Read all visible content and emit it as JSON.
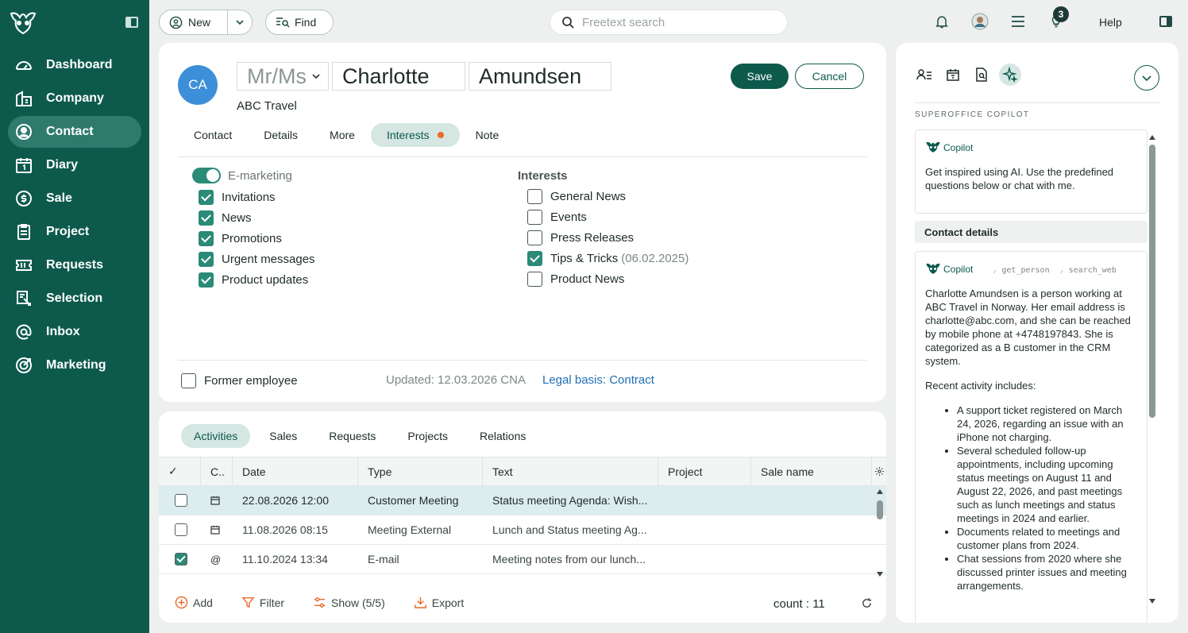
{
  "nav": {
    "items": [
      {
        "label": "Dashboard",
        "icon": "dashboard-icon"
      },
      {
        "label": "Company",
        "icon": "company-icon"
      },
      {
        "label": "Contact",
        "icon": "contact-icon"
      },
      {
        "label": "Diary",
        "icon": "diary-icon"
      },
      {
        "label": "Sale",
        "icon": "sale-icon"
      },
      {
        "label": "Project",
        "icon": "project-icon"
      },
      {
        "label": "Requests",
        "icon": "requests-icon"
      },
      {
        "label": "Selection",
        "icon": "selection-icon"
      },
      {
        "label": "Inbox",
        "icon": "inbox-icon"
      },
      {
        "label": "Marketing",
        "icon": "marketing-icon"
      }
    ],
    "active_index": 2
  },
  "topbar": {
    "new_label": "New",
    "find_label": "Find",
    "search_placeholder": "Freetext search",
    "notification_badge": "3",
    "help_label": "Help"
  },
  "contact": {
    "initials": "CA",
    "salutation": "Mr/Ms",
    "first_name": "Charlotte",
    "last_name": "Amundsen",
    "company": "ABC Travel",
    "save_label": "Save",
    "cancel_label": "Cancel",
    "tabs": [
      "Contact",
      "Details",
      "More",
      "Interests",
      "Note"
    ],
    "active_tab": "Interests"
  },
  "interests": {
    "emarketing_label": "E-marketing",
    "emarketing_on": true,
    "marketing_items": [
      {
        "label": "Invitations",
        "checked": true
      },
      {
        "label": "News",
        "checked": true
      },
      {
        "label": "Promotions",
        "checked": true
      },
      {
        "label": "Urgent messages",
        "checked": true
      },
      {
        "label": "Product updates",
        "checked": true
      }
    ],
    "heading": "Interests",
    "interest_items": [
      {
        "label": "General News",
        "checked": false,
        "date": ""
      },
      {
        "label": "Events",
        "checked": false,
        "date": ""
      },
      {
        "label": "Press Releases",
        "checked": false,
        "date": ""
      },
      {
        "label": "Tips & Tricks",
        "checked": true,
        "date": "(06.02.2025)"
      },
      {
        "label": "Product News",
        "checked": false,
        "date": ""
      }
    ],
    "former_employee_label": "Former employee",
    "updated_text": "Updated: 12.03.2026 CNA",
    "legal_basis_text": "Legal basis: Contract"
  },
  "activities": {
    "tabs": [
      "Activities",
      "Sales",
      "Requests",
      "Projects",
      "Relations"
    ],
    "active_tab": "Activities",
    "columns": {
      "check": "✓",
      "c": "C..",
      "date": "Date",
      "type": "Type",
      "text": "Text",
      "project": "Project",
      "sale": "Sale name"
    },
    "rows": [
      {
        "checked": false,
        "icon": "calendar-icon",
        "date": "22.08.2026 12:00",
        "type": "Customer Meeting",
        "text": "Status meeting Agenda: Wish...",
        "project": "",
        "sale": "",
        "selected": true
      },
      {
        "checked": false,
        "icon": "calendar-icon",
        "date": "11.08.2026 08:15",
        "type": "Meeting External",
        "text": "Lunch and Status meeting Ag...",
        "project": "",
        "sale": "",
        "selected": false
      },
      {
        "checked": true,
        "icon": "email-icon",
        "date": "11.10.2024 13:34",
        "type": "E-mail",
        "text": "Meeting notes from our lunch...",
        "project": "",
        "sale": "",
        "selected": false
      }
    ],
    "footer": {
      "add": "Add",
      "filter": "Filter",
      "show": "Show (5/5)",
      "export": "Export",
      "count": "count : 11"
    }
  },
  "copilot": {
    "section_label": "SUPEROFFICE COPILOT",
    "name": "Copilot",
    "intro": "Get inspired using AI. Use the predefined questions below or chat with me.",
    "contact_details_label": "Contact details",
    "tools": [
      "get_person",
      "search_web"
    ],
    "summary": "Charlotte Amundsen is a person working at ABC Travel in Norway. Her email address is charlotte@abc.com, and she can be reached by mobile phone at +4748197843. She is categorized as a B customer in the CRM system.",
    "recent_label": "Recent activity includes:",
    "bullets": [
      "A support ticket registered on March 24, 2026, regarding an issue with an iPhone not charging.",
      "Several scheduled follow-up appointments, including upcoming status meetings on August 11 and August 22, 2026, and past meetings such as lunch meetings and status meetings in 2024 and earlier.",
      "Documents related to meetings and customer plans from 2024.",
      "Chat sessions from 2020 where she discussed printer issues and meeting arrangements."
    ]
  },
  "colors": {
    "brand": "#0d5a4d",
    "accent": "#2b8a78",
    "notification_dot": "#f06a24",
    "avatar": "#3c8fd8",
    "link": "#1f6eb5"
  }
}
